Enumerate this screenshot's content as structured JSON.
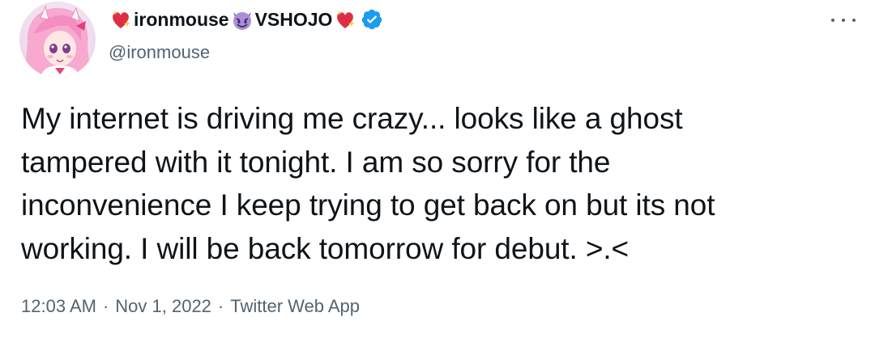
{
  "author": {
    "name_part1": "ironmouse",
    "name_part2": "VSHOJO",
    "handle": "@ironmouse",
    "verified": true,
    "name_emojis": [
      "sparkling-heart",
      "smiling-imp",
      "sparkling-heart"
    ]
  },
  "tweet": {
    "lines": [
      "My internet is driving me crazy... looks like a ghost",
      "tampered with it tonight. I am so sorry for the",
      "inconvenience I keep trying to get back on but its not",
      "working. I will be back tomorrow for debut. >.<"
    ],
    "time": "12:03 AM",
    "date": "Nov 1, 2022",
    "source": "Twitter Web App",
    "separator": "·"
  },
  "colors": {
    "text": "#0f1419",
    "secondary": "#536471",
    "verified": "#1d9bf0",
    "heart": "#e0245e",
    "imp": "#8a5cc7"
  },
  "icons": {
    "more": "more-options-icon",
    "verified": "verified-badge-icon"
  }
}
